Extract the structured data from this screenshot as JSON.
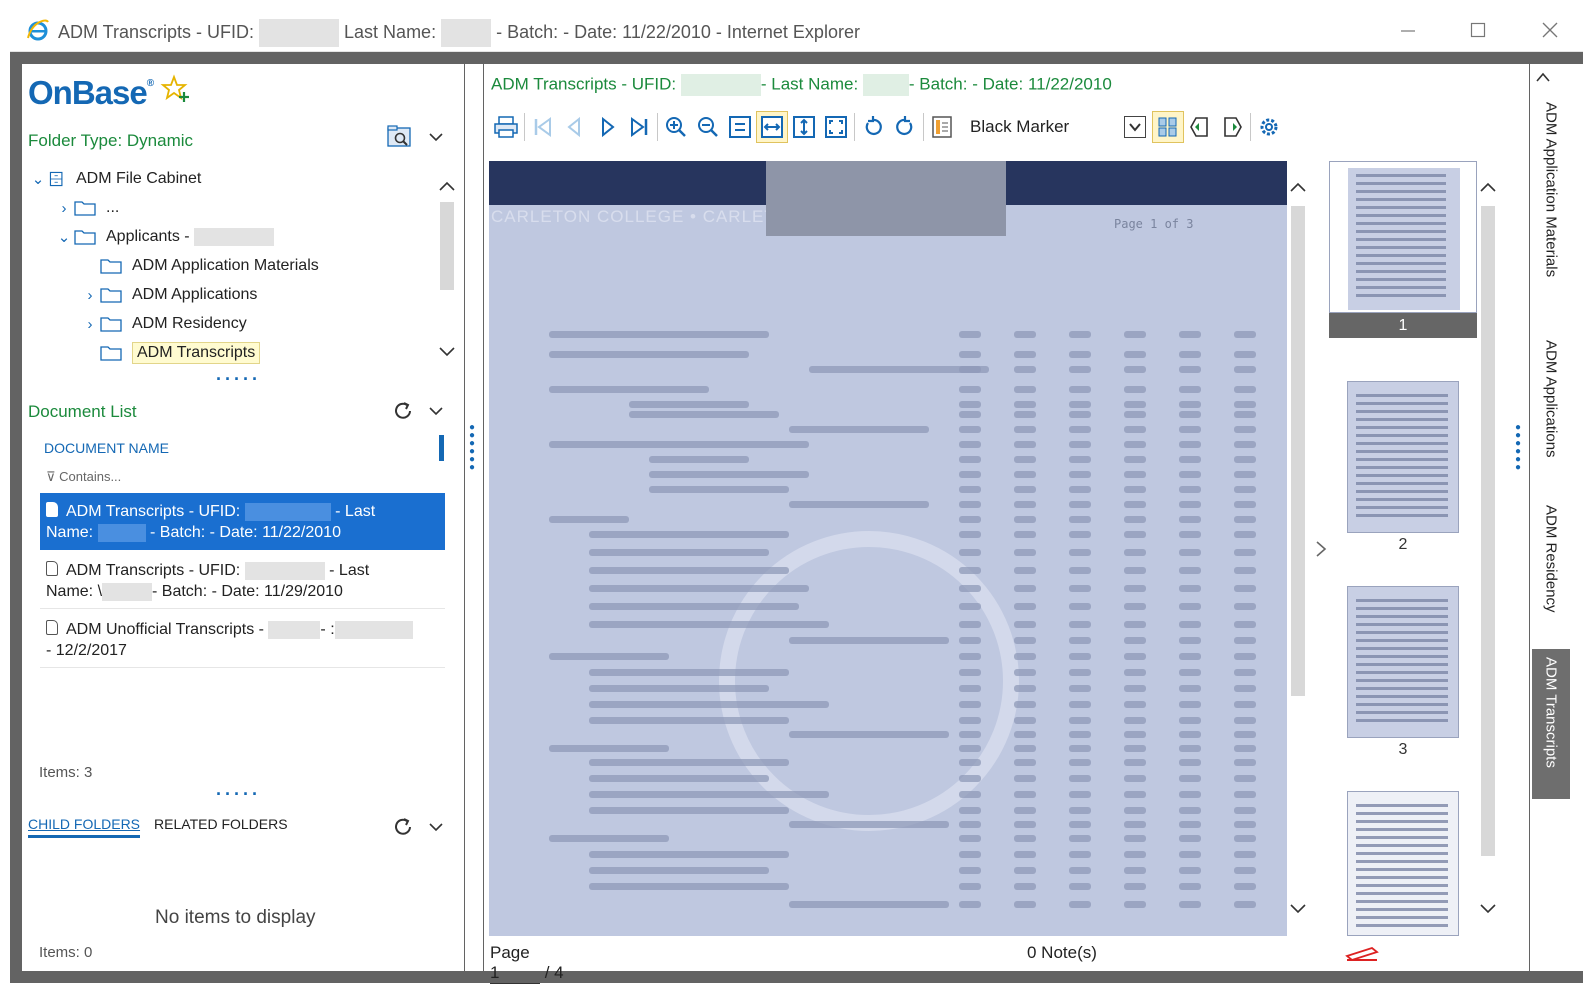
{
  "window": {
    "title_prefix": "ADM Transcripts - UFID: ",
    "title_mid": "Last Name: ",
    "title_suffix": "- Batch: - Date: 11/22/2010 - Internet Explorer"
  },
  "left": {
    "logo": "OnBase",
    "logo_mark": "®",
    "folder_type": "Folder Type: Dynamic",
    "tree": {
      "root": "ADM File Cabinet",
      "ellipsis": "...",
      "applicants": "Applicants -",
      "children": [
        "ADM Application Materials",
        "ADM Applications",
        "ADM Residency",
        "ADM Transcripts"
      ]
    },
    "doc_list": {
      "header": "Document List",
      "column": "DOCUMENT NAME",
      "filter_placeholder": "Contains...",
      "items": [
        {
          "l1a": "ADM Transcripts - UFID: ",
          "l1b": "- Last",
          "l2a": "Name: ",
          "l2b": "- Batch: - Date: 11/22/2010"
        },
        {
          "l1a": "ADM Transcripts - UFID: ",
          "l1b": "- Last",
          "l2a": "Name: \\",
          "l2b": "- Batch: - Date: 11/29/2010"
        },
        {
          "l1a": "ADM Unofficial Transcripts - ",
          "l1b": "- :",
          "l2a": "- 12/2/2017",
          "l2b": ""
        }
      ],
      "items_count": "Items: 3"
    },
    "folders": {
      "tab_child": "CHILD FOLDERS",
      "tab_related": "RELATED FOLDERS",
      "empty": "No items to display",
      "items_count": "Items: 0"
    }
  },
  "viewer": {
    "title_a": "ADM Transcripts - UFID: ",
    "title_b": "- Last Name: ",
    "title_c": "- Batch: - Date: 11/22/2010",
    "marker": "Black Marker",
    "page_watermark": "Page 1 of 3",
    "thumbs": [
      "1",
      "2",
      "3"
    ],
    "status": {
      "page_label": "Page 1",
      "page_total": "/ 4",
      "notes": "0 Note(s)"
    }
  },
  "side_tabs": [
    "ADM Application Materials",
    "ADM Applications",
    "ADM Residency",
    "ADM Transcripts"
  ],
  "colors": {
    "accent": "#1468b4",
    "green": "#1b8a3c",
    "selected": "#1a6fd0"
  }
}
